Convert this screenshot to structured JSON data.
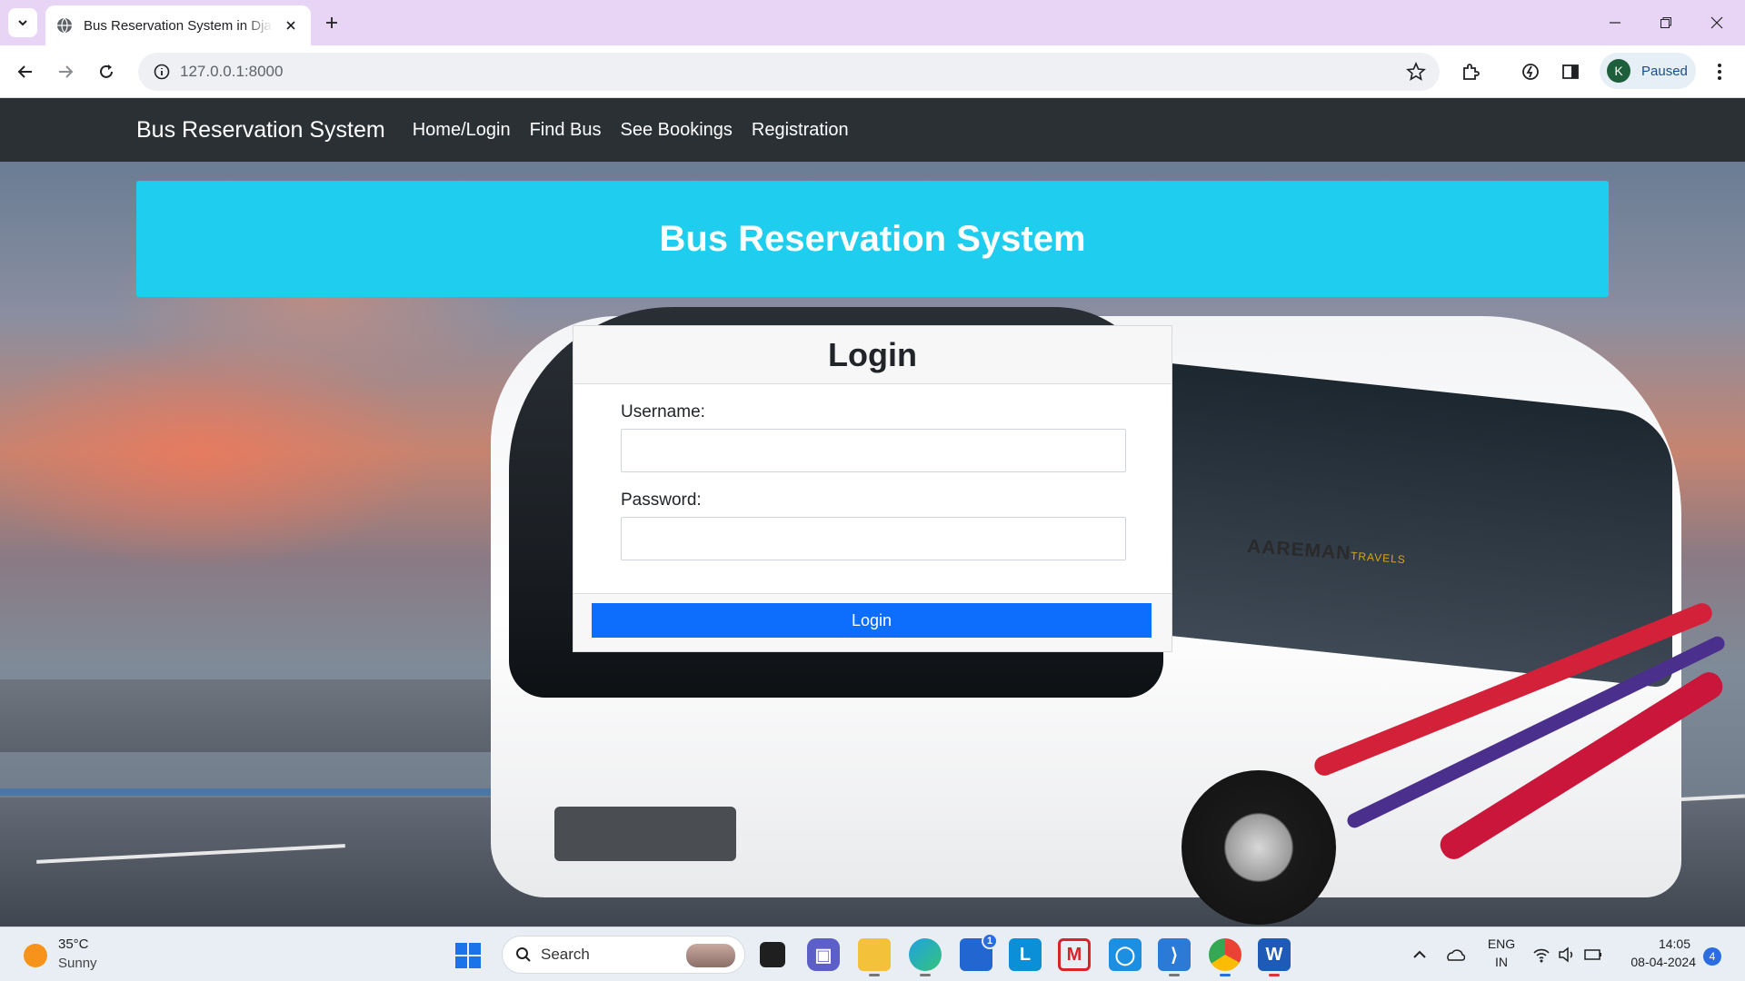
{
  "browser": {
    "tab_title": "Bus Reservation System in Djan",
    "url": "127.0.0.1:8000",
    "profile_initial": "K",
    "profile_status": "Paused"
  },
  "navbar": {
    "brand": "Bus Reservation System",
    "links": [
      "Home/Login",
      "Find Bus",
      "See Bookings",
      "Registration"
    ]
  },
  "hero": {
    "title": "Bus Reservation System"
  },
  "bus_graphic": {
    "logo_text": "AAREMAN",
    "logo_suffix": "TRAVELS"
  },
  "login": {
    "title": "Login",
    "username_label": "Username:",
    "username_value": "",
    "password_label": "Password:",
    "password_value": "",
    "button_label": "Login"
  },
  "taskbar": {
    "weather_temp": "35°C",
    "weather_desc": "Sunny",
    "search_placeholder": "Search",
    "store_badge": "1",
    "lang_top": "ENG",
    "lang_bottom": "IN",
    "time": "14:05",
    "date": "08-04-2024",
    "notification_count": "4"
  },
  "colors": {
    "navbar_bg": "#2b3035",
    "hero_bg": "#1fcdee",
    "login_button": "#0d6efd",
    "tabstrip_bg": "#e8d5f5"
  }
}
